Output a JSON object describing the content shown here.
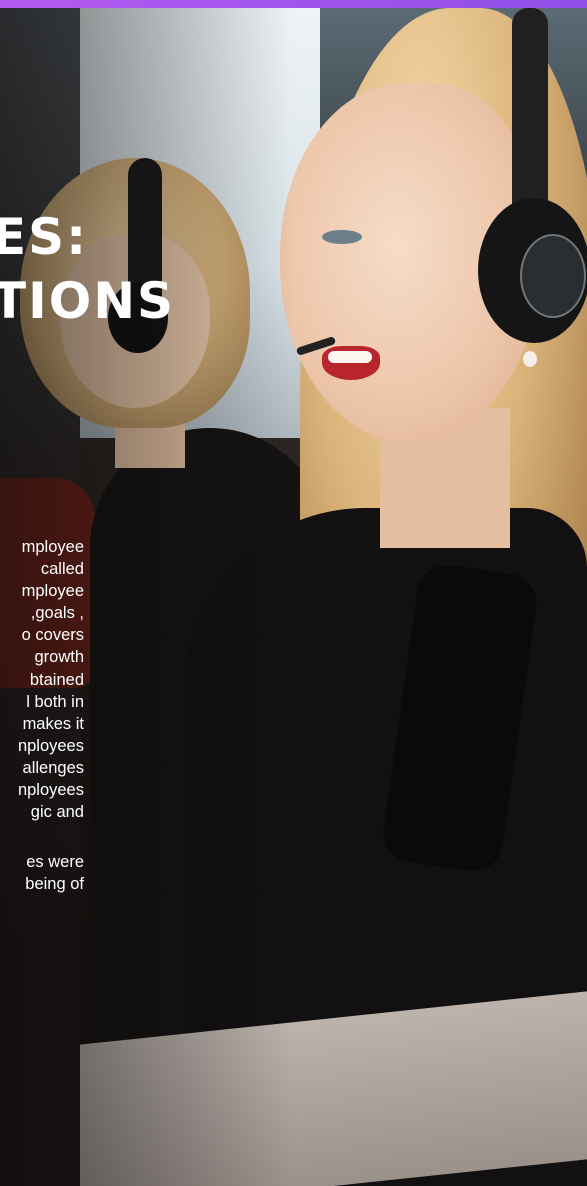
{
  "colors": {
    "top_bar": "#a855f0",
    "text": "#ffffff"
  },
  "heading": {
    "line1": "ES:",
    "line2": "TIONS"
  },
  "paragraph1": [
    "mployee",
    "called",
    "mployee",
    ", goals,",
    "o covers",
    "growth",
    "btained",
    "l both in",
    "makes it",
    "nployees",
    "allenges",
    "nployees",
    "gic and"
  ],
  "paragraph2": [
    "es were",
    "being of"
  ]
}
